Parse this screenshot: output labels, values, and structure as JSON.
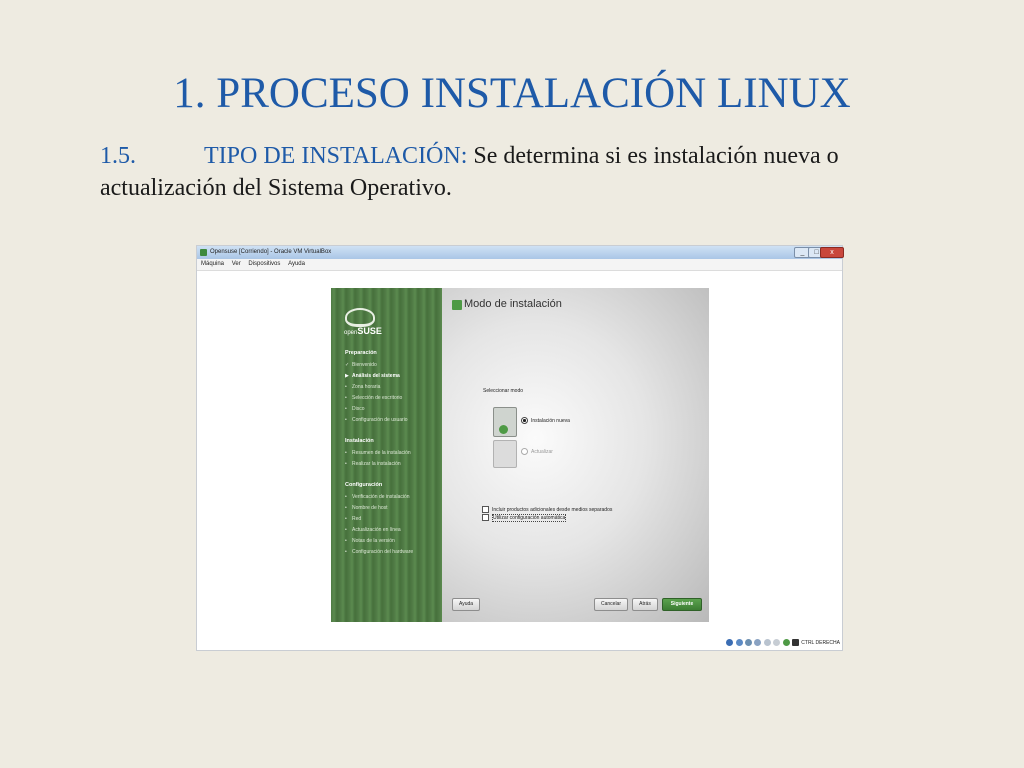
{
  "slide": {
    "title": "1. PROCESO INSTALACIÓN LINUX",
    "section_number": "1.5.",
    "section_label": "TIPO DE INSTALACIÓN:",
    "section_text": " Se determina si es instalación nueva o actualización del Sistema Operativo."
  },
  "window": {
    "title": "Opensuse [Corriendo] - Oracle VM VirtualBox",
    "menu": [
      "Máquina",
      "Ver",
      "Dispositivos",
      "Ayuda"
    ],
    "controls": {
      "minimize": "_",
      "maximize": "□",
      "close": "x"
    },
    "status": {
      "host_key": "CTRL DERECHA"
    }
  },
  "installer": {
    "brand_prefix": "open",
    "brand_name": "SUSE",
    "sidebar": {
      "groups": [
        {
          "label": "Preparación",
          "items": [
            {
              "label": "Bienvenido",
              "marker": "✓"
            },
            {
              "label": "Análisis del sistema",
              "marker": "▶"
            },
            {
              "label": "Zona horaria",
              "marker": "•"
            },
            {
              "label": "Selección de escritorio",
              "marker": "•"
            },
            {
              "label": "Disco",
              "marker": "•"
            },
            {
              "label": "Configuración de usuario",
              "marker": "•"
            }
          ]
        },
        {
          "label": "Instalación",
          "items": [
            {
              "label": "Resumen de la instalación",
              "marker": "•"
            },
            {
              "label": "Realizar la instalación",
              "marker": "•"
            }
          ]
        },
        {
          "label": "Configuración",
          "items": [
            {
              "label": "Verificación de instalación",
              "marker": "•"
            },
            {
              "label": "Nombre de host",
              "marker": "•"
            },
            {
              "label": "Red",
              "marker": "•"
            },
            {
              "label": "Actualización en línea",
              "marker": "•"
            },
            {
              "label": "Notas de la versión",
              "marker": "•"
            },
            {
              "label": "Configuración del hardware",
              "marker": "•"
            }
          ]
        }
      ]
    },
    "page_title": "Modo de instalación",
    "select_mode_label": "Seleccionar modo",
    "option_new": "Instalación nueva",
    "option_update": "Actualizar",
    "check_addons": "Incluir productos adicionales desde medios separados",
    "check_autoconfig": "Utilizar configuración automática",
    "buttons": {
      "help": "Ayuda",
      "cancel": "Cancelar",
      "back": "Atrás",
      "next": "Siguiente"
    }
  },
  "colors": {
    "slide_bg": "#eeebe1",
    "title_blue": "#1e5aa8",
    "suse_green": "#4f7a44"
  }
}
